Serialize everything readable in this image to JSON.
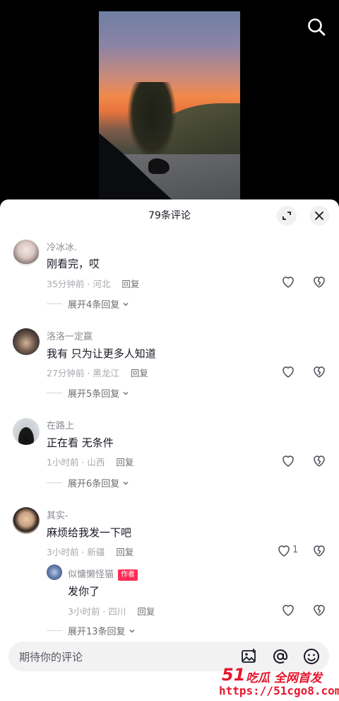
{
  "sheet": {
    "title": "79条评论"
  },
  "comments": [
    {
      "name": "冷冰冰.",
      "text": "刚看完，哎",
      "meta": "35分钟前 · 河北",
      "reply": "回复",
      "expand": "展开4条回复"
    },
    {
      "name": "洛洛一定赢",
      "text": "我有 只为让更多人知道",
      "meta": "27分钟前 · 黑龙江",
      "reply": "回复",
      "expand": "展开5条回复"
    },
    {
      "name": "在路上",
      "text": "正在看 无条件",
      "meta": "1小时前 · 山西",
      "reply": "回复",
      "expand": "展开6条回复"
    },
    {
      "name": "其实-",
      "text": "麻烦给我发一下吧",
      "meta": "3小时前 · 新疆",
      "reply": "回复",
      "like_count": "1",
      "expand": "展开13条回复"
    }
  ],
  "sub_reply": {
    "name": "似慵懒怪猫",
    "tag": "作者",
    "text": "发你了",
    "meta": "3小时前 · 四川",
    "reply": "回复"
  },
  "input": {
    "placeholder": "期待你的评论"
  },
  "watermark": {
    "brand": "51",
    "slogan": "吃瓜 全网首发",
    "url": "https://51cgo8.com"
  },
  "colors": {
    "accent": "#fe2c55",
    "watermark": "#e6162d"
  }
}
